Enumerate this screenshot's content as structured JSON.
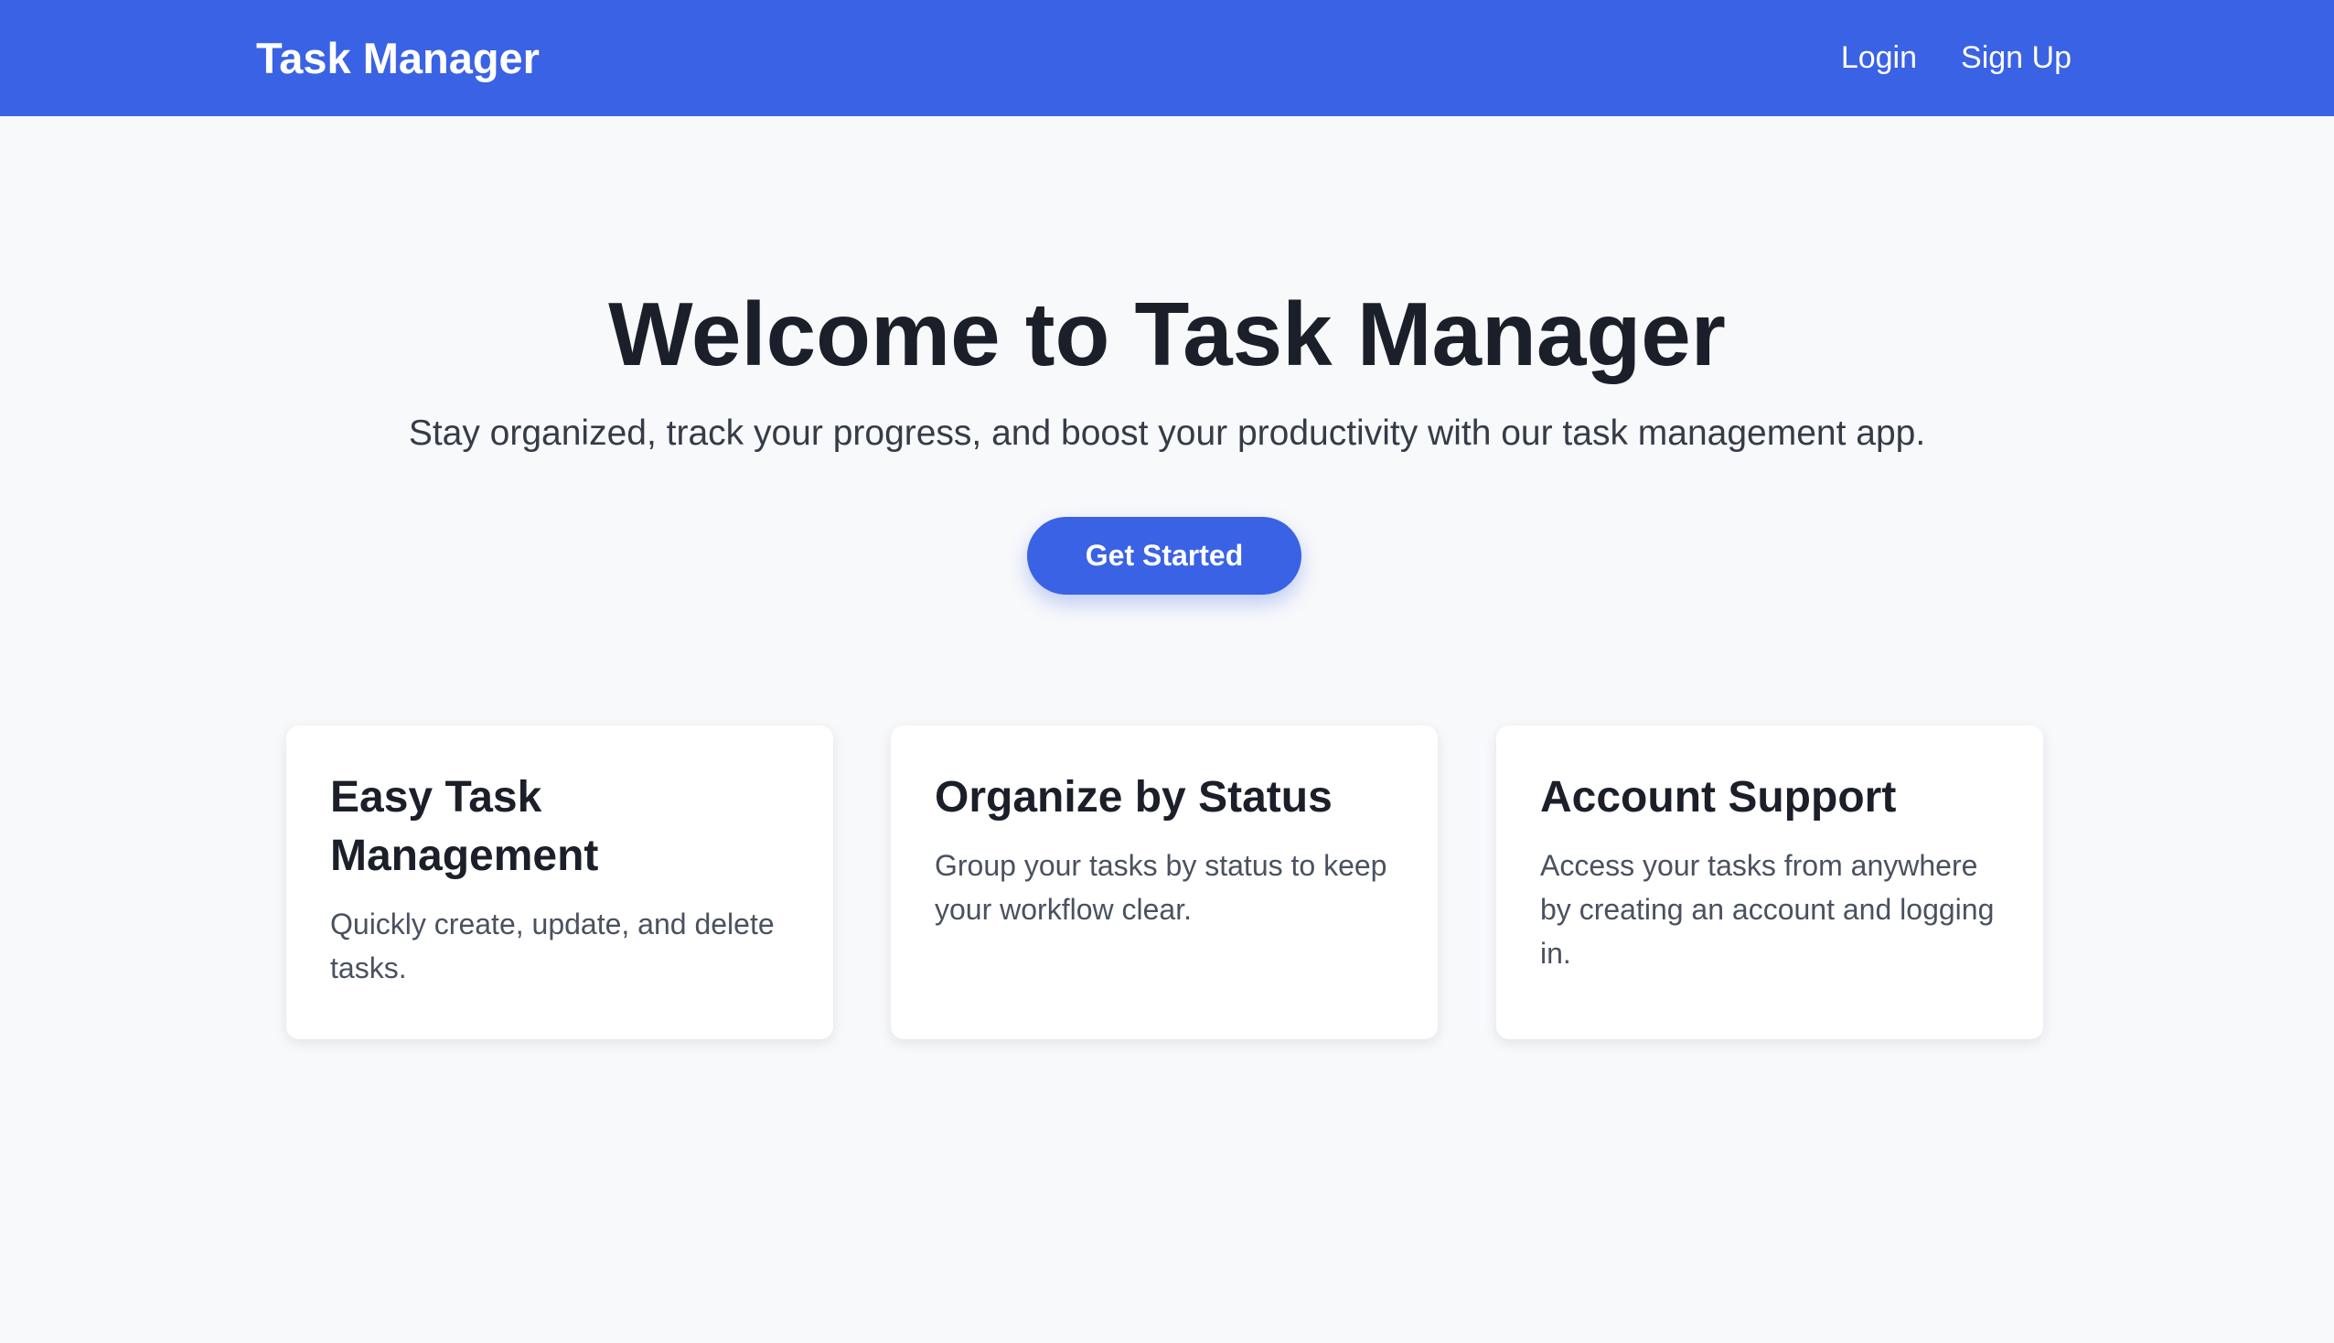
{
  "navbar": {
    "brand": "Task Manager",
    "links": [
      {
        "label": "Login"
      },
      {
        "label": "Sign Up"
      }
    ]
  },
  "hero": {
    "title": "Welcome to Task Manager",
    "subtitle": "Stay organized, track your progress, and boost your productivity with our task management app.",
    "cta_label": "Get Started"
  },
  "features": [
    {
      "title": "Easy Task Management",
      "text": "Quickly create, update, and delete tasks."
    },
    {
      "title": "Organize by Status",
      "text": "Group your tasks by status to keep your workflow clear."
    },
    {
      "title": "Account Support",
      "text": "Access your tasks from anywhere by creating an account and logging in."
    }
  ],
  "colors": {
    "primary": "#3a62e4",
    "background": "#f8f9fb",
    "heading": "#1b1f29",
    "body_text": "#4a5160",
    "card": "#ffffff"
  }
}
